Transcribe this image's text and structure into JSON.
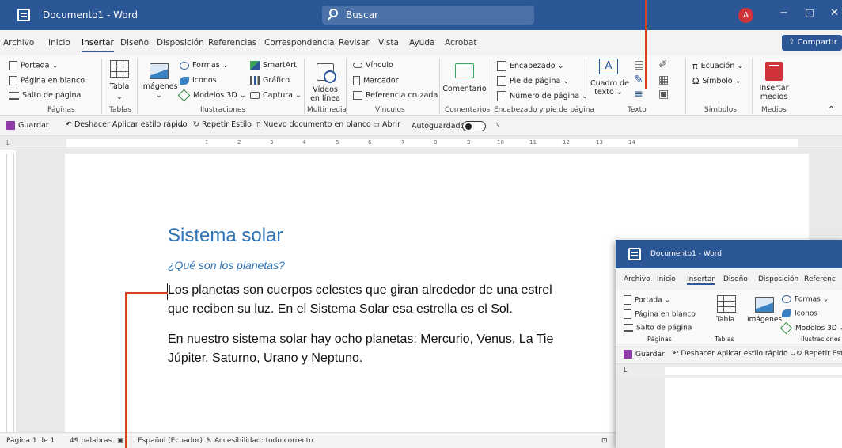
{
  "colors": {
    "accent": "#2b5797",
    "title_blue": "#2e74b5",
    "callout": "#d9401e",
    "avatar": "#d13438"
  },
  "titlebar": {
    "doc_title": "Documento1  -  Word",
    "search_placeholder": "Buscar",
    "avatar_initial": "A",
    "minimize": "−",
    "maximize": "▢",
    "close": "✕"
  },
  "tabs": [
    "Archivo",
    "Inicio",
    "Insertar",
    "Diseño",
    "Disposición",
    "Referencias",
    "Correspondencia",
    "Revisar",
    "Vista",
    "Ayuda",
    "Acrobat"
  ],
  "share_label": "Compartir",
  "ribbon": {
    "paginas": {
      "portada": "Portada",
      "pagina_blanco": "Página en blanco",
      "salto": "Salto de página",
      "group": "Páginas"
    },
    "tablas": {
      "tabla": "Tabla",
      "group": "Tablas"
    },
    "ilustraciones": {
      "imagenes": "Imágenes",
      "formas": "Formas",
      "iconos": "Iconos",
      "modelos3d": "Modelos 3D",
      "smartart": "SmartArt",
      "grafico": "Gráfico",
      "captura": "Captura",
      "group": "Ilustraciones"
    },
    "multimedia": {
      "videos_l1": "Vídeos",
      "videos_l2": "en línea",
      "group": "Multimedia"
    },
    "vinculos": {
      "vinculo": "Vínculo",
      "marcador": "Marcador",
      "referencia": "Referencia cruzada",
      "group": "Vínculos"
    },
    "comentarios": {
      "comentario": "Comentario",
      "group": "Comentarios"
    },
    "encabezado": {
      "encabezado": "Encabezado",
      "pie": "Pie de página",
      "numero": "Número de página",
      "group": "Encabezado y pie de página"
    },
    "texto": {
      "cuadro_l1": "Cuadro de",
      "cuadro_l2": "texto",
      "group": "Texto"
    },
    "simbolos": {
      "ecuacion": "Ecuación",
      "simbolo": "Símbolo",
      "group": "Símbolos"
    },
    "medios": {
      "insertar_l1": "Insertar",
      "insertar_l2": "medios",
      "group": "Medios"
    }
  },
  "quick_access": {
    "guardar": "Guardar",
    "deshacer": "Deshacer Aplicar estilo rápido",
    "repetir": "Repetir Estilo",
    "nuevo": "Nuevo documento en blanco",
    "abrir": "Abrir",
    "autoguardado": "Autoguardado"
  },
  "ruler_numbers": [
    "1",
    "2",
    "3",
    "4",
    "5",
    "6",
    "7",
    "8",
    "9",
    "10",
    "11",
    "12",
    "13",
    "14"
  ],
  "document": {
    "title": "Sistema solar",
    "subtitle": "¿Qué son los planetas?",
    "p1_l1": "Los planetas son cuerpos celestes que giran alrededor de una estrel",
    "p1_l2": "que reciben su luz. En el Sistema Solar esa estrella es el Sol.",
    "p2_l1": "En nuestro sistema solar hay ocho planetas: Mercurio, Venus, La Tie",
    "p2_l2": "Júpiter, Saturno, Urano y Neptuno."
  },
  "status": {
    "page": "Página 1 de 1",
    "words": "49 palabras",
    "language": "Español (Ecuador)",
    "accessibility": "Accesibilidad: todo correcto"
  },
  "inset": {
    "title": "Documento1  -  Word",
    "tabs": [
      "Archivo",
      "Inicio",
      "Insertar",
      "Diseño",
      "Disposición",
      "Referenc"
    ],
    "portada": "Portada",
    "pagina_blanco": "Página en blanco",
    "salto": "Salto de página",
    "paginas": "Páginas",
    "tabla": "Tabla",
    "tablas": "Tablas",
    "imagenes": "Imágenes",
    "formas": "Formas",
    "iconos": "Iconos",
    "modelos3d": "Modelos 3D",
    "ilustraciones": "Ilustraciones",
    "guardar": "Guardar",
    "deshacer": "Deshacer Aplicar estilo rápido",
    "repetir": "Repetir Estilo"
  }
}
